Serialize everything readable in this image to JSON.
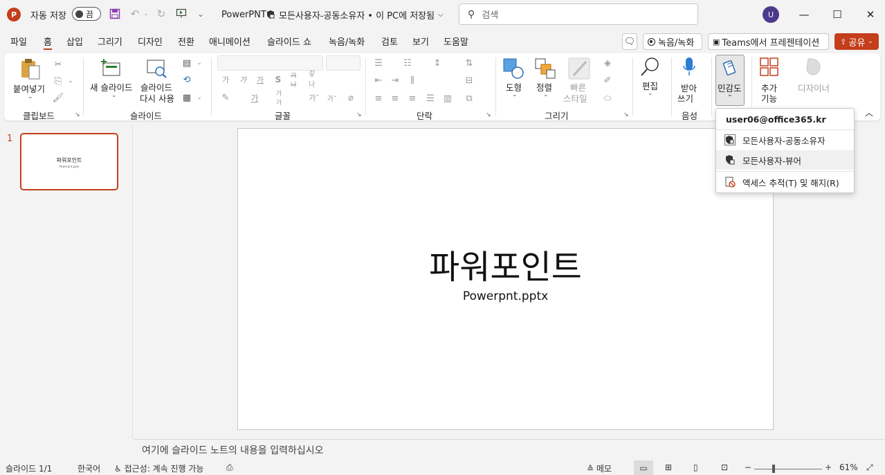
{
  "titlebar": {
    "app_logo": "P",
    "autosave_label": "자동 저장",
    "autosave_state": "끔",
    "doc_title": "PowerPNT",
    "doc_label": "모든사용자-공동소유자",
    "doc_status": "• 이 PC에 저장됨",
    "search_placeholder": "검색",
    "avatar_initial": "U"
  },
  "tabs": [
    "파일",
    "홈",
    "삽입",
    "그리기",
    "디자인",
    "전환",
    "애니메이션",
    "슬라이드 쇼",
    "녹음/녹화",
    "검토",
    "보기",
    "도움말"
  ],
  "active_tab": "홈",
  "tab_actions": {
    "record": "녹음/녹화",
    "teams": "Teams에서 프레젠테이션",
    "share": "공유"
  },
  "ribbon": {
    "paste": "붙여넣기",
    "clipboard_group": "클립보드",
    "new_slide": "새 슬라이드",
    "reuse_slide_1": "슬라이드",
    "reuse_slide_2": "다시 사용",
    "slides_group": "슬라이드",
    "font_group": "글꼴",
    "paragraph_group": "단락",
    "shapes": "도형",
    "arrange": "정렬",
    "quick_styles_1": "빠른",
    "quick_styles_2": "스타일",
    "drawing_group": "그리기",
    "edit": "편집",
    "dictate_1": "받아",
    "dictate_2": "쓰기",
    "voice_group": "음성",
    "sensitivity": "민감도",
    "addins_1": "추가",
    "addins_2": "기능",
    "designer": "디자이너"
  },
  "sensitivity_menu": {
    "account": "user06@office365.kr",
    "items": [
      "모든사용자-공동소유자",
      "모든사용자-뷰어",
      "액세스 추적(T) 및 해지(R)"
    ]
  },
  "slide_panel": {
    "number": "1",
    "thumb_title": "파워포인트",
    "thumb_subtitle": "Powerpnt.pptx"
  },
  "slide": {
    "title": "파워포인트",
    "subtitle": "Powerpnt.pptx"
  },
  "notes_placeholder": "여기에 슬라이드 노트의 내용을 입력하십시오",
  "statusbar": {
    "slide_count": "슬라이드 1/1",
    "language": "한국어",
    "accessibility": "접근성: 계속 진행 가능",
    "notes": "메모",
    "zoom": "61%"
  },
  "colors": {
    "accent": "#c43e1c",
    "avatar": "#4b3a8c"
  }
}
